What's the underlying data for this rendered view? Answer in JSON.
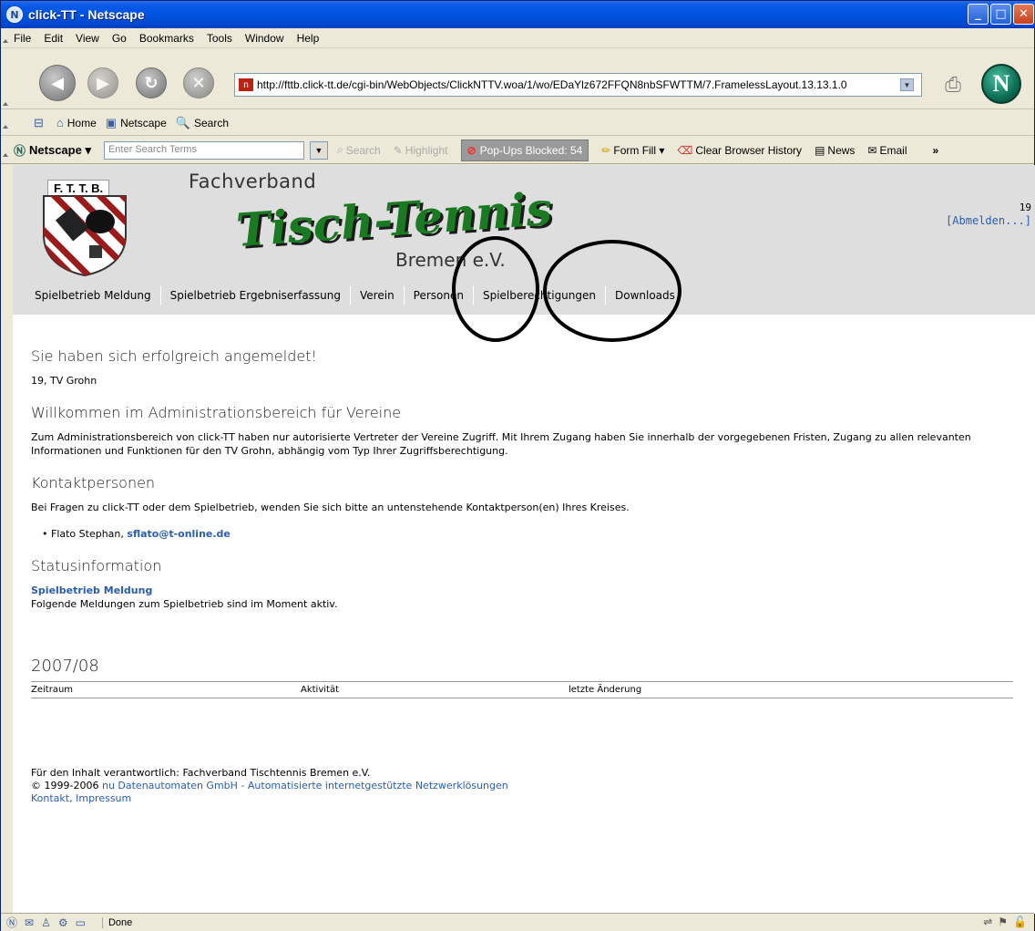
{
  "window": {
    "title": "click-TT - Netscape"
  },
  "menu": [
    "File",
    "Edit",
    "View",
    "Go",
    "Bookmarks",
    "Tools",
    "Window",
    "Help"
  ],
  "nav": {
    "url": "http://fttb.click-tt.de/cgi-bin/WebObjects/ClickNTTV.woa/1/wo/EDaYlz672FFQN8nbSFWTTM/7.FramelessLayout.13.13.1.0"
  },
  "personal_toolbar": {
    "home": "Home",
    "my_netscape": "Netscape",
    "search": "Search"
  },
  "search_toolbar": {
    "brand": "Netscape",
    "placeholder": "Enter Search Terms",
    "search": "Search",
    "highlight": "Highlight",
    "popups": "Pop-Ups Blocked: 54",
    "form_fill": "Form Fill",
    "clear_history": "Clear Browser History",
    "news": "News",
    "email": "Email",
    "more": "»"
  },
  "banner": {
    "logo_text": "F. T. T. B.",
    "fachverband": "Fachverband",
    "tischtennis": "Tisch-Tennis",
    "bremen": "Bremen e.V.",
    "user_num": "19",
    "logout": "[Abmelden...]"
  },
  "topnav": [
    "Spielbetrieb Meldung",
    "Spielbetrieb Ergebniserfassung",
    "Verein",
    "Personen",
    "Spielberechtigungen",
    "Downloads"
  ],
  "main": {
    "login_heading": "Sie haben sich erfolgreich angemeldet!",
    "club": "19, TV Grohn",
    "welcome_heading": "Willkommen im Administrationsbereich für Vereine",
    "welcome_text": "Zum Administrationsbereich von click-TT haben nur autorisierte Vertreter der Vereine Zugriff. Mit Ihrem Zugang haben Sie innerhalb der vorgegebenen Fristen, Zugang zu allen relevanten Informationen und Funktionen für den TV Grohn, abhängig vom Typ Ihrer Zugriffsberechtigung.",
    "contact_heading": "Kontaktpersonen",
    "contact_text": "Bei Fragen zu click-TT oder dem Spielbetrieb, wenden Sie sich bitte an untenstehende Kontaktperson(en) Ihres Kreises.",
    "contact_name": "Flato Stephan,",
    "contact_email": "sflato@t-online.de",
    "status_heading": "Statusinformation",
    "status_link": "Spielbetrieb Meldung",
    "status_text": "Folgende Meldungen zum Spielbetrieb sind im Moment aktiv.",
    "season": "2007/08",
    "table_headers": [
      "Zeitraum",
      "Aktivität",
      "letzte Änderung"
    ]
  },
  "footer": {
    "line1": "Für den Inhalt verantwortlich: Fachverband Tischtennis Bremen e.V.",
    "copyright": "© 1999-2006",
    "company_link": "nu Datenautomaten GmbH - Automatisierte internetgestützte Netzwerklösungen",
    "kontakt": "Kontakt",
    "impressum": "Impressum"
  },
  "status": {
    "text": "Done"
  }
}
